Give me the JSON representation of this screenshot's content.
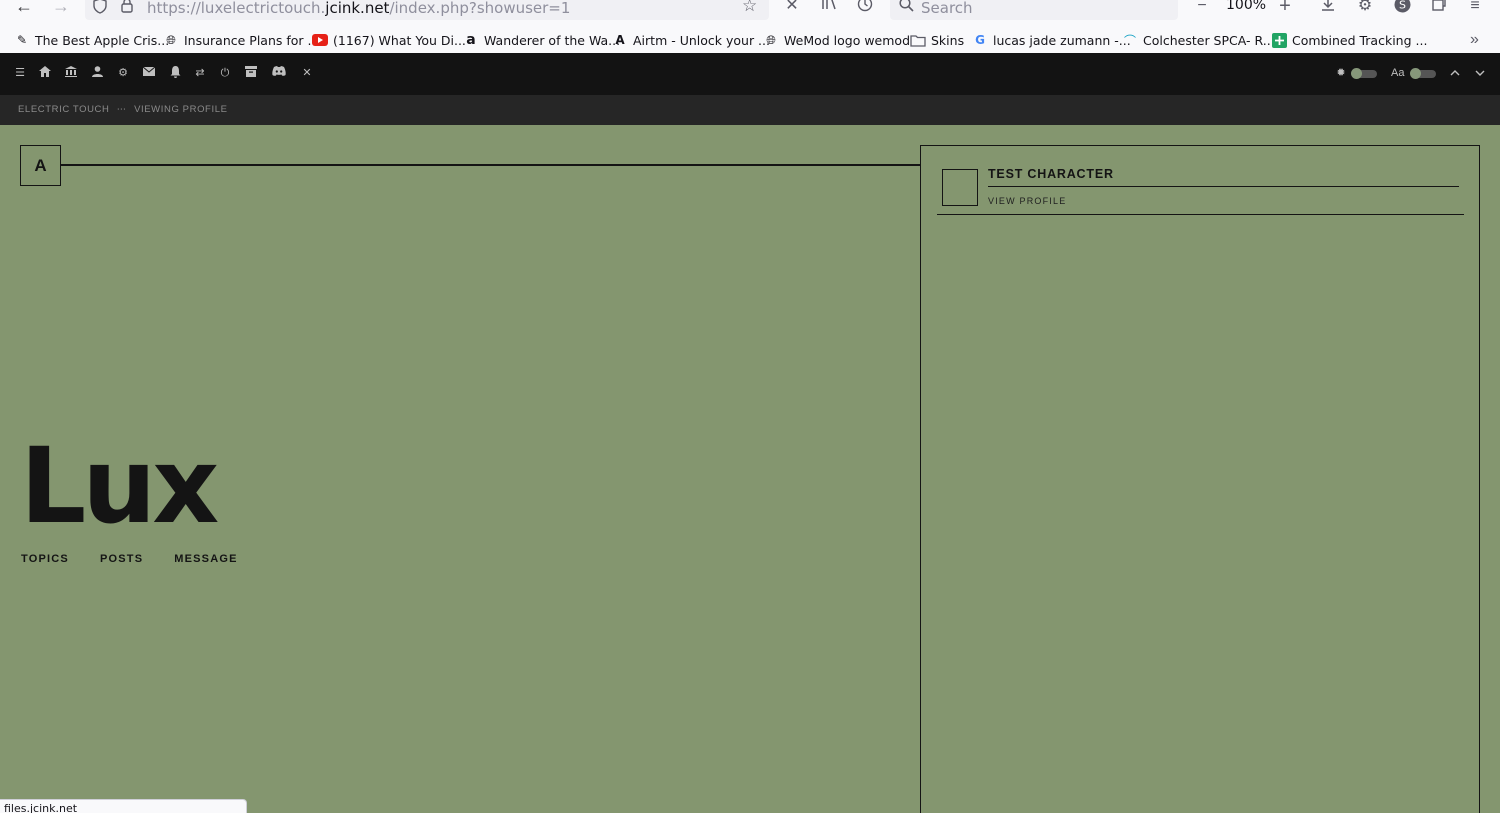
{
  "browser": {
    "url_prefix": "https://luxelectrictouch.",
    "url_domain": "jcink.net",
    "url_path": "/index.php?showuser=1",
    "search_placeholder": "Search",
    "zoom_level": "100%",
    "bookmarks": [
      {
        "label": "The Best Apple Cris...",
        "icon": "pen-icon"
      },
      {
        "label": "Insurance Plans for ...",
        "icon": "globe-icon"
      },
      {
        "label": "(1167) What You Di...",
        "icon": "youtube-icon"
      },
      {
        "label": "Wanderer of the Wa...",
        "icon": "amazon-icon"
      },
      {
        "label": "Airtm - Unlock your ...",
        "icon": "airtm-icon"
      },
      {
        "label": "WeMod logo wemod",
        "icon": "globe-icon"
      },
      {
        "label": "Skins",
        "icon": "folder-icon"
      },
      {
        "label": "lucas jade zumann -...",
        "icon": "google-icon"
      },
      {
        "label": "Colchester SPCA- R...",
        "icon": "spca-icon"
      },
      {
        "label": "Combined Tracking ...",
        "icon": "sheets-icon"
      }
    ],
    "status_text": "files.jcink.net"
  },
  "forum_toolbar": {
    "font_label": "Aa"
  },
  "breadcrumb": {
    "site": "ELECTRIC TOUCH",
    "separator": "⋯",
    "page": "VIEWING PROFILE"
  },
  "profile": {
    "avatar_letter": "A",
    "name": "Lux",
    "links": [
      "TOPICS",
      "POSTS",
      "MESSAGE"
    ]
  },
  "characters": [
    {
      "name": "TEST CHARACTER",
      "link_label": "VIEW PROFILE"
    }
  ],
  "colors": {
    "page_bg": "#84966f",
    "ink": "#141414",
    "toolbar_bg": "#131313",
    "crumb_bg": "#262626"
  }
}
